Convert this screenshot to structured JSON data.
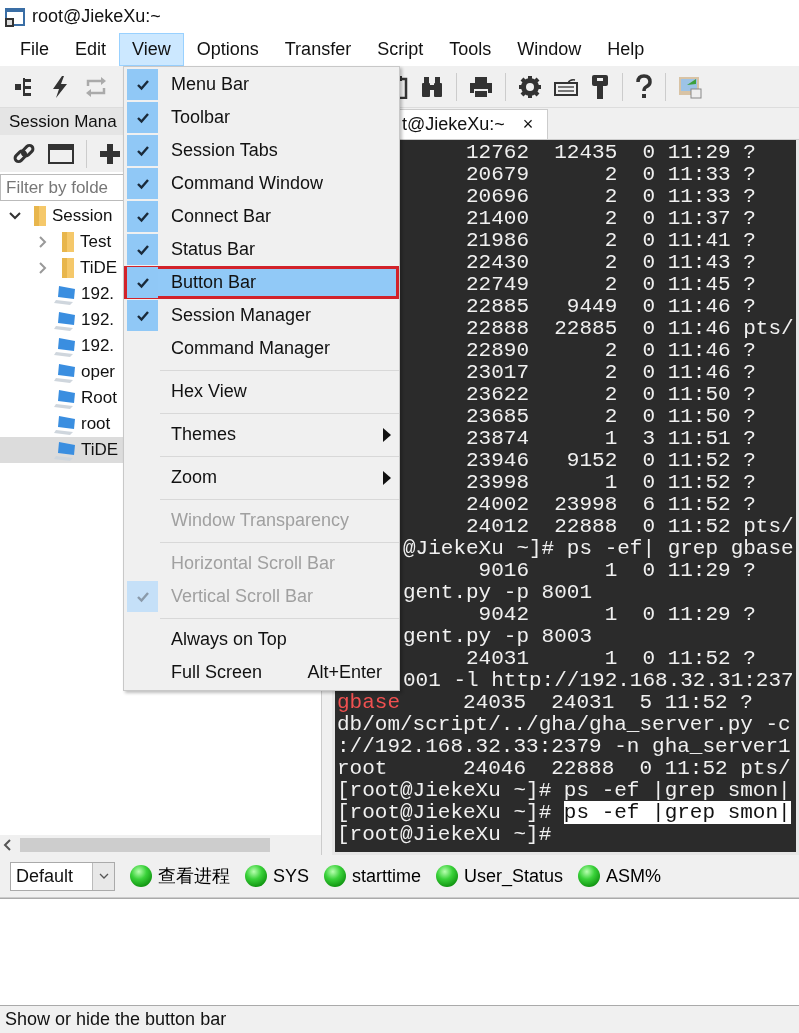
{
  "window": {
    "title": "root@JiekeXu:~"
  },
  "menu_bar": [
    {
      "label": "File",
      "selected": false
    },
    {
      "label": "Edit",
      "selected": false
    },
    {
      "label": "View",
      "selected": true
    },
    {
      "label": "Options",
      "selected": false
    },
    {
      "label": "Transfer",
      "selected": false
    },
    {
      "label": "Script",
      "selected": false
    },
    {
      "label": "Tools",
      "selected": false
    },
    {
      "label": "Window",
      "selected": false
    },
    {
      "label": "Help",
      "selected": false
    }
  ],
  "session_manager": {
    "title": "Session Mana",
    "filter": {
      "placeholder": "Filter by folde"
    },
    "tree": [
      {
        "label": "Session",
        "kind": "folder",
        "expanded": true,
        "selected": false,
        "children": [
          {
            "label": "Test",
            "kind": "folder",
            "expanded": false,
            "selected": false
          },
          {
            "label": "TiDE",
            "kind": "folder",
            "expanded": false,
            "selected": false
          },
          {
            "label": "192.",
            "kind": "session",
            "selected": false
          },
          {
            "label": "192.",
            "kind": "session",
            "selected": false
          },
          {
            "label": "192.",
            "kind": "session",
            "selected": false
          },
          {
            "label": "oper",
            "kind": "session",
            "selected": false
          },
          {
            "label": "Root",
            "kind": "session",
            "selected": false
          },
          {
            "label": "root",
            "kind": "session",
            "selected": false
          },
          {
            "label": "TiDE",
            "kind": "session",
            "selected": true
          }
        ]
      }
    ]
  },
  "tabs": [
    {
      "label": "t@JiekeXu:~",
      "close": "×",
      "selected": true
    }
  ],
  "terminal": {
    "lines": [
      {
        "covered": true,
        "text": "     12762  12435  0 11:29 ?"
      },
      {
        "covered": true,
        "text": "     20679      2  0 11:33 ?"
      },
      {
        "covered": true,
        "text": "     20696      2  0 11:33 ?"
      },
      {
        "covered": true,
        "text": "     21400      2  0 11:37 ?"
      },
      {
        "covered": true,
        "text": "     21986      2  0 11:41 ?"
      },
      {
        "covered": true,
        "text": "     22430      2  0 11:43 ?"
      },
      {
        "covered": true,
        "text": "     22749      2  0 11:45 ?"
      },
      {
        "covered": true,
        "text": "     22885   9449  0 11:46 ?"
      },
      {
        "covered": true,
        "text": "     22888  22885  0 11:46 pts/"
      },
      {
        "covered": true,
        "text": "     22890      2  0 11:46 ?"
      },
      {
        "covered": true,
        "text": "     23017      2  0 11:46 ?"
      },
      {
        "covered": true,
        "text": "     23622      2  0 11:50 ?"
      },
      {
        "covered": true,
        "text": "     23685      2  0 11:50 ?"
      },
      {
        "covered": true,
        "text": "     23874      1  3 11:51 ?"
      },
      {
        "covered": true,
        "text": "     23946   9152  0 11:52 ?"
      },
      {
        "covered": true,
        "text": "     23998      1  0 11:52 ?"
      },
      {
        "covered": true,
        "text": "     24002  23998  6 11:52 ?"
      },
      {
        "covered": true,
        "text": "     24012  22888  0 11:52 pts/"
      },
      {
        "covered": true,
        "text": "@JiekeXu ~]# ps -ef| grep gbase"
      },
      {
        "covered": true,
        "text": "      9016      1  0 11:29 ?"
      },
      {
        "covered": true,
        "text": "gent.py -p 8001"
      },
      {
        "covered": true,
        "text": "      9042      1  0 11:29 ?"
      },
      {
        "covered": true,
        "text": "gent.py -p 8003"
      },
      {
        "covered": true,
        "text": "     24031      1  0 11:52 ?"
      },
      {
        "covered": true,
        "text": "001 -l http://192.168.32.31:237"
      },
      {
        "covered": false,
        "segments": [
          {
            "kind": "match",
            "text": "gbase"
          },
          {
            "kind": "plain",
            "text": "     24035  24031  5 11:52 ?"
          }
        ]
      },
      {
        "covered": false,
        "text": "db/om/script/../gha/gha_server.py -c"
      },
      {
        "covered": false,
        "text": "://192.168.32.33:2379 -n gha_server1"
      },
      {
        "covered": false,
        "text": "root      24046  22888  0 11:52 pts/"
      },
      {
        "covered": false,
        "text": "[root@JiekeXu ~]# ps -ef |grep smon|"
      },
      {
        "covered": false,
        "segments": [
          {
            "kind": "plain",
            "text": "[root@JiekeXu ~]# "
          },
          {
            "kind": "selection",
            "text": "ps -ef |grep smon|"
          }
        ]
      },
      {
        "covered": false,
        "text": "[root@JiekeXu ~]#"
      }
    ]
  },
  "view_menu": {
    "items": [
      {
        "kind": "item",
        "label": "Menu Bar",
        "checked": true,
        "disabled": false,
        "selected": false,
        "submenu": false,
        "annotated": false
      },
      {
        "kind": "item",
        "label": "Toolbar",
        "checked": true,
        "disabled": false,
        "selected": false,
        "submenu": false,
        "annotated": false
      },
      {
        "kind": "item",
        "label": "Session Tabs",
        "checked": true,
        "disabled": false,
        "selected": false,
        "submenu": false,
        "annotated": false
      },
      {
        "kind": "item",
        "label": "Command Window",
        "checked": true,
        "disabled": false,
        "selected": false,
        "submenu": false,
        "annotated": false
      },
      {
        "kind": "item",
        "label": "Connect Bar",
        "checked": true,
        "disabled": false,
        "selected": false,
        "submenu": false,
        "annotated": false
      },
      {
        "kind": "item",
        "label": "Status Bar",
        "checked": true,
        "disabled": false,
        "selected": false,
        "submenu": false,
        "annotated": false
      },
      {
        "kind": "item",
        "label": "Button Bar",
        "checked": true,
        "disabled": false,
        "selected": true,
        "submenu": false,
        "annotated": true
      },
      {
        "kind": "item",
        "label": "Session Manager",
        "checked": true,
        "disabled": false,
        "selected": false,
        "submenu": false,
        "annotated": false
      },
      {
        "kind": "item",
        "label": "Command Manager",
        "checked": false,
        "disabled": false,
        "selected": false,
        "submenu": false,
        "annotated": false
      },
      {
        "kind": "separator"
      },
      {
        "kind": "item",
        "label": "Hex View",
        "checked": false,
        "disabled": false,
        "selected": false,
        "submenu": false,
        "annotated": false
      },
      {
        "kind": "separator"
      },
      {
        "kind": "item",
        "label": "Themes",
        "checked": false,
        "disabled": false,
        "selected": false,
        "submenu": true,
        "annotated": false
      },
      {
        "kind": "separator"
      },
      {
        "kind": "item",
        "label": "Zoom",
        "checked": false,
        "disabled": false,
        "selected": false,
        "submenu": true,
        "annotated": false
      },
      {
        "kind": "separator"
      },
      {
        "kind": "item",
        "label": "Window Transparency",
        "checked": false,
        "disabled": true,
        "selected": false,
        "submenu": false,
        "annotated": false
      },
      {
        "kind": "separator"
      },
      {
        "kind": "item",
        "label": "Horizontal Scroll Bar",
        "checked": false,
        "disabled": true,
        "selected": false,
        "submenu": false,
        "annotated": false
      },
      {
        "kind": "item",
        "label": "Vertical Scroll Bar",
        "checked": true,
        "disabled": true,
        "selected": false,
        "submenu": false,
        "annotated": false
      },
      {
        "kind": "separator"
      },
      {
        "kind": "item",
        "label": "Always on Top",
        "checked": false,
        "disabled": false,
        "selected": false,
        "submenu": false,
        "annotated": false
      },
      {
        "kind": "item",
        "label": "Full Screen",
        "shortcut": "Alt+Enter",
        "checked": false,
        "disabled": false,
        "selected": false,
        "submenu": false,
        "annotated": false
      }
    ]
  },
  "button_bar": {
    "dropdown": {
      "value": "Default"
    },
    "buttons": [
      {
        "label": "查看进程"
      },
      {
        "label": "SYS"
      },
      {
        "label": "starttime"
      },
      {
        "label": "User_Status"
      },
      {
        "label": "ASM%"
      }
    ]
  },
  "status_bar": {
    "text": "Show or hide the button bar"
  }
}
